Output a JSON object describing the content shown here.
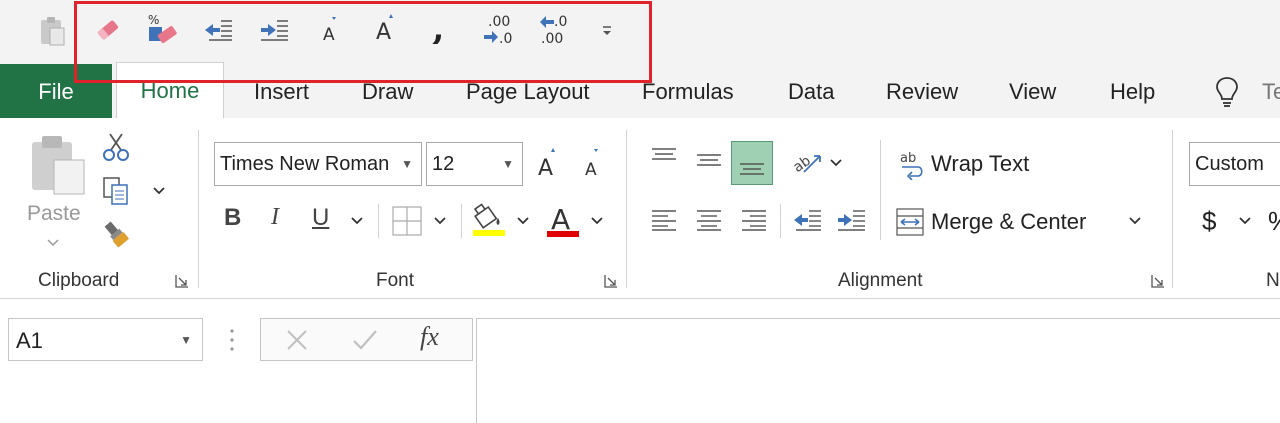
{
  "tabs": {
    "file": "File",
    "home": "Home",
    "insert": "Insert",
    "draw": "Draw",
    "page_layout": "Page Layout",
    "formulas": "Formulas",
    "data": "Data",
    "review": "Review",
    "view": "View",
    "help": "Help",
    "tell_me_partial": "Te"
  },
  "quick_access": {
    "decimal_increase_top": ".00",
    "decimal_increase_bottom": ".0",
    "decimal_decrease_top": ".0",
    "decimal_decrease_bottom": ".00",
    "percent_glyph": "%",
    "font_grow_glyph": "A",
    "font_shrink_glyph": "A",
    "comma_glyph": ","
  },
  "clipboard": {
    "paste_label": "Paste",
    "group_label": "Clipboard"
  },
  "font": {
    "font_name": "Times New Roman",
    "font_size": "12",
    "bold_glyph": "B",
    "italic_glyph": "I",
    "underline_glyph": "U",
    "font_color_glyph": "A",
    "grow_glyph": "A",
    "shrink_glyph": "A",
    "group_label": "Font"
  },
  "alignment": {
    "wrap_text_label": "Wrap Text",
    "wrap_icon_glyph": "ab",
    "merge_center_label": "Merge & Center",
    "group_label": "Alignment"
  },
  "number": {
    "format_value": "Custom",
    "currency_glyph": "$",
    "percent_partial": "%",
    "group_label_partial": "N"
  },
  "formula_bar": {
    "name_box_value": "A1",
    "fx_label": "fx"
  },
  "colors": {
    "file_tab": "#217346",
    "highlight_fill": "#ffff00",
    "font_color_bar": "#e00000",
    "qat_highlight_border": "#e0222a"
  }
}
